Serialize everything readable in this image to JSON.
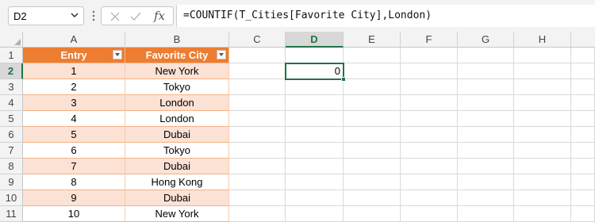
{
  "formula_bar": {
    "name_box": "D2",
    "formula": "=COUNTIF(T_Cities[Favorite City],London)",
    "fx_label": "fx"
  },
  "columns": [
    "A",
    "B",
    "C",
    "D",
    "E",
    "F",
    "G",
    "H"
  ],
  "rows": [
    "1",
    "2",
    "3",
    "4",
    "5",
    "6",
    "7",
    "8",
    "9",
    "10",
    "11"
  ],
  "table": {
    "headers": [
      "Entry",
      "Favorite City"
    ],
    "rows": [
      [
        "1",
        "New York"
      ],
      [
        "2",
        "Tokyo"
      ],
      [
        "3",
        "London"
      ],
      [
        "4",
        "London"
      ],
      [
        "5",
        "Dubai"
      ],
      [
        "6",
        "Tokyo"
      ],
      [
        "7",
        "Dubai"
      ],
      [
        "8",
        "Hong Kong"
      ],
      [
        "9",
        "Dubai"
      ],
      [
        "10",
        "New York"
      ]
    ],
    "header_color": "#ed7d31",
    "band_color": "#fbe2d5"
  },
  "result_cell": {
    "ref": "D2",
    "value": "0"
  },
  "colors": {
    "accent": "#217346"
  }
}
